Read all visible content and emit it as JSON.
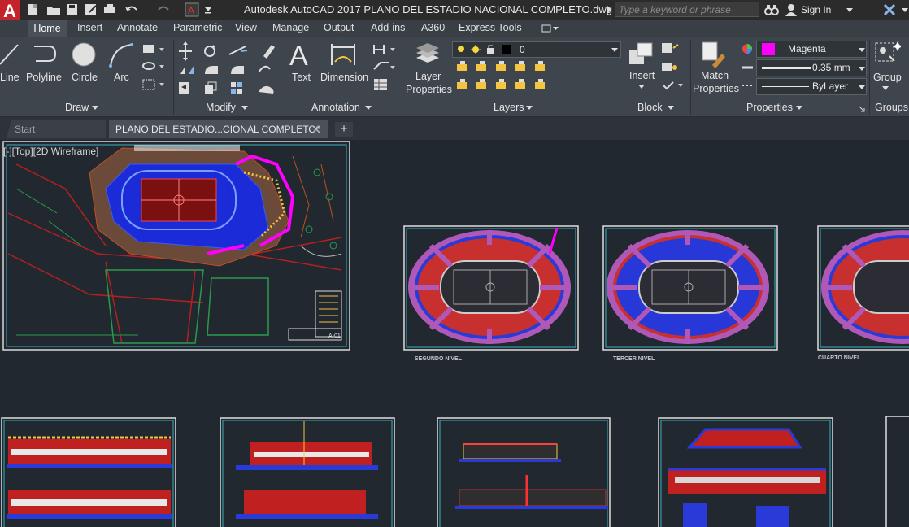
{
  "app": {
    "logo_letter": "A",
    "title": "Autodesk AutoCAD 2017    PLANO DEL ESTADIO NACIONAL COMPLETO.dwg",
    "search_placeholder": "Type a keyword or phrase",
    "sign_in": "Sign In"
  },
  "ribbon_tabs": [
    "Home",
    "Insert",
    "Annotate",
    "Parametric",
    "View",
    "Manage",
    "Output",
    "Add-ins",
    "A360",
    "Express Tools"
  ],
  "ribbon": {
    "draw": {
      "line": "Line",
      "polyline": "Polyline",
      "circle": "Circle",
      "arc": "Arc",
      "panel": "Draw"
    },
    "modify": {
      "panel": "Modify"
    },
    "annotation": {
      "text": "Text",
      "dimension": "Dimension",
      "panel": "Annotation"
    },
    "layers": {
      "layer_properties_1": "Layer",
      "layer_properties_2": "Properties",
      "current_layer": "0",
      "panel": "Layers"
    },
    "block": {
      "insert": "Insert",
      "panel": "Block"
    },
    "properties": {
      "match_1": "Match",
      "match_2": "Properties",
      "color": "Magenta",
      "lineweight": "0.35 mm",
      "linetype": "ByLayer",
      "panel": "Properties"
    },
    "groups": {
      "group": "Group",
      "panel": "Groups"
    }
  },
  "file_tabs": {
    "start": "Start",
    "current": "PLANO DEL ESTADIO...CIONAL COMPLETO*",
    "add": "+"
  },
  "viewport": {
    "label": "[-][Top][2D Wireframe]"
  },
  "sheets": {
    "level2": "SEGUNDO NIVEL",
    "level3": "TERCER NIVEL",
    "level4": "CUARTO NIVEL",
    "sheet_code": "A-01"
  },
  "colors": {
    "accent_magenta": "#ff00ff",
    "logo_red": "#c4232b",
    "model_bg": "#212830"
  }
}
